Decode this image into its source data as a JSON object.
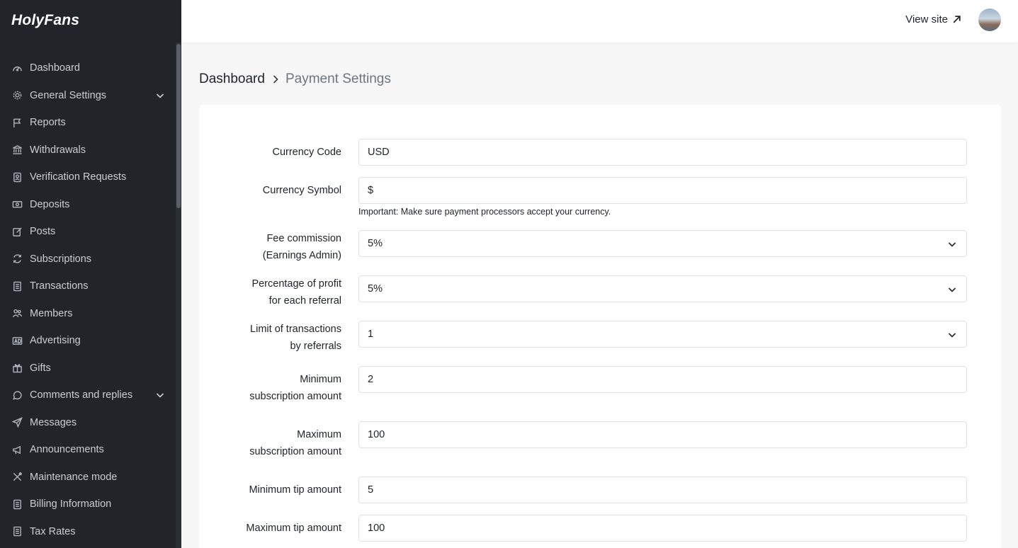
{
  "app": {
    "brand": "HolyFans"
  },
  "sidebar": {
    "items": [
      {
        "label": "Dashboard",
        "icon": "speedometer-icon",
        "chevron": false
      },
      {
        "label": "General Settings",
        "icon": "gear-icon",
        "chevron": true
      },
      {
        "label": "Reports",
        "icon": "flag-icon",
        "chevron": false
      },
      {
        "label": "Withdrawals",
        "icon": "bank-icon",
        "chevron": false
      },
      {
        "label": "Verification Requests",
        "icon": "id-badge-icon",
        "chevron": false
      },
      {
        "label": "Deposits",
        "icon": "cash-icon",
        "chevron": false
      },
      {
        "label": "Posts",
        "icon": "pencil-square-icon",
        "chevron": false
      },
      {
        "label": "Subscriptions",
        "icon": "refresh-icon",
        "chevron": false
      },
      {
        "label": "Transactions",
        "icon": "receipt-icon",
        "chevron": false
      },
      {
        "label": "Members",
        "icon": "people-icon",
        "chevron": false
      },
      {
        "label": "Advertising",
        "icon": "ad-icon",
        "chevron": false
      },
      {
        "label": "Gifts",
        "icon": "gift-icon",
        "chevron": false
      },
      {
        "label": "Comments and replies",
        "icon": "chat-icon",
        "chevron": true
      },
      {
        "label": "Messages",
        "icon": "send-icon",
        "chevron": false
      },
      {
        "label": "Announcements",
        "icon": "megaphone-icon",
        "chevron": false
      },
      {
        "label": "Maintenance mode",
        "icon": "tools-icon",
        "chevron": false
      },
      {
        "label": "Billing Information",
        "icon": "receipt-icon",
        "chevron": false
      },
      {
        "label": "Tax Rates",
        "icon": "receipt-icon",
        "chevron": false
      }
    ]
  },
  "header": {
    "view_site": "View site"
  },
  "breadcrumb": {
    "home": "Dashboard",
    "current": "Payment Settings"
  },
  "form": {
    "currency_code": {
      "label": "Currency Code",
      "value": "USD"
    },
    "currency_symbol": {
      "label": "Currency Symbol",
      "value": "$",
      "help": "Important: Make sure payment processors accept your currency."
    },
    "fee_commission": {
      "label_line1": "Fee commission",
      "label_line2": "(Earnings Admin)",
      "value": "5%"
    },
    "referral_profit": {
      "label_line1": "Percentage of profit",
      "label_line2": "for each referral",
      "value": "5%"
    },
    "referral_limit": {
      "label_line1": "Limit of transactions",
      "label_line2": "by referrals",
      "value": "1"
    },
    "min_subscription": {
      "label_line1": "Minimum",
      "label_line2": "subscription amount",
      "value": "2"
    },
    "max_subscription": {
      "label_line1": "Maximum",
      "label_line2": "subscription amount",
      "value": "100"
    },
    "min_tip": {
      "label": "Minimum tip amount",
      "value": "5"
    },
    "max_tip": {
      "label": "Maximum tip amount",
      "value": "100"
    }
  }
}
